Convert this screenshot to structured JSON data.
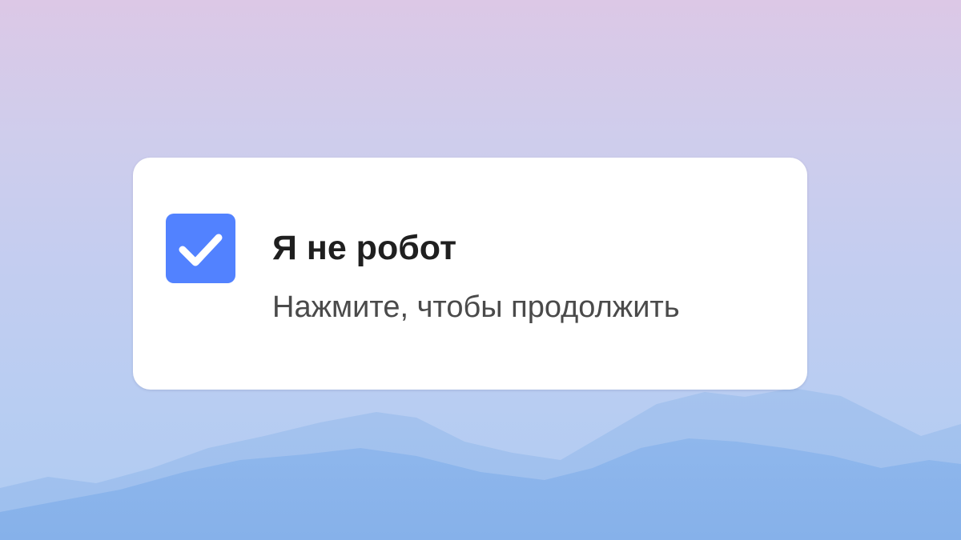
{
  "captcha": {
    "title": "Я не робот",
    "subtitle": "Нажмите, чтобы продолжить",
    "checked": true,
    "accent_color": "#5282ff"
  },
  "icons": {
    "checkmark": "checkmark-icon"
  }
}
